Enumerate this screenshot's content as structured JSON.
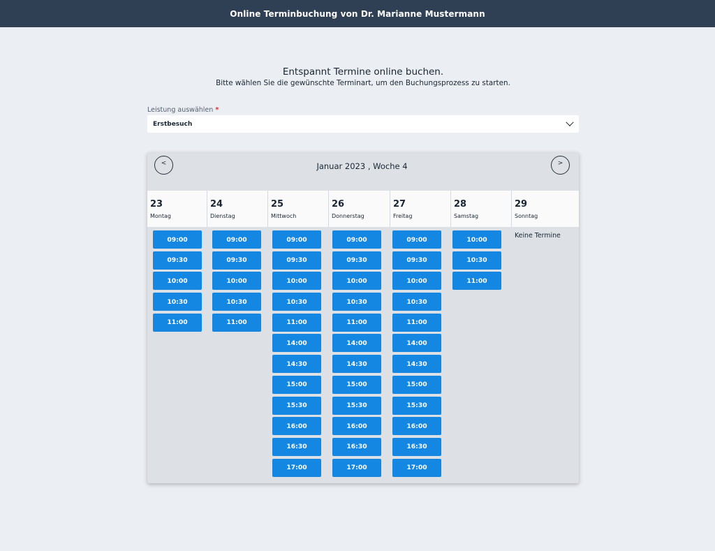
{
  "header": {
    "title": "Online Terminbuchung von Dr. Marianne Mustermann"
  },
  "intro": {
    "headline": "Entspannt Termine online buchen.",
    "subline": "Bitte wählen Sie die gewünschte Terminart, um den Buchungsprozess zu starten."
  },
  "service": {
    "label": "Leistung auswählen",
    "required_mark": "*",
    "value": "Erstbesuch"
  },
  "calendar": {
    "title": "Januar 2023 , Woche 4",
    "prev_label": "<",
    "next_label": ">",
    "no_slots_text": "Keine Termine",
    "days": [
      {
        "num": "23",
        "name": "Montag",
        "slots": [
          "09:00",
          "09:30",
          "10:00",
          "10:30",
          "11:00"
        ]
      },
      {
        "num": "24",
        "name": "Dienstag",
        "slots": [
          "09:00",
          "09:30",
          "10:00",
          "10:30",
          "11:00"
        ]
      },
      {
        "num": "25",
        "name": "Mittwoch",
        "slots": [
          "09:00",
          "09:30",
          "10:00",
          "10:30",
          "11:00",
          "14:00",
          "14:30",
          "15:00",
          "15:30",
          "16:00",
          "16:30",
          "17:00"
        ]
      },
      {
        "num": "26",
        "name": "Donnerstag",
        "slots": [
          "09:00",
          "09:30",
          "10:00",
          "10:30",
          "11:00",
          "14:00",
          "14:30",
          "15:00",
          "15:30",
          "16:00",
          "16:30",
          "17:00"
        ]
      },
      {
        "num": "27",
        "name": "Freitag",
        "slots": [
          "09:00",
          "09:30",
          "10:00",
          "10:30",
          "11:00",
          "14:00",
          "14:30",
          "15:00",
          "15:30",
          "16:00",
          "16:30",
          "17:00"
        ]
      },
      {
        "num": "28",
        "name": "Samstag",
        "slots": [
          "10:00",
          "10:30",
          "11:00"
        ]
      },
      {
        "num": "29",
        "name": "Sonntag",
        "slots": []
      }
    ]
  },
  "colors": {
    "header_bg": "#2f3f54",
    "slot_bg": "#1487e3",
    "page_bg": "#ebeef2"
  }
}
